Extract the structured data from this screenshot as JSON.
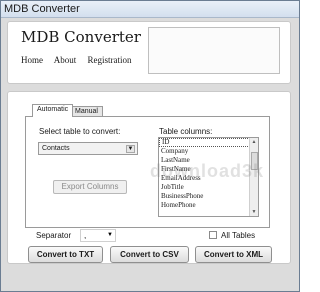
{
  "window": {
    "title": "MDB Converter"
  },
  "header": {
    "app_name": "MDB Converter",
    "nav": [
      "Home",
      "About",
      "Registration"
    ]
  },
  "tabs": [
    {
      "label": "Automatic",
      "active": true
    },
    {
      "label": "Manual",
      "active": false
    }
  ],
  "select_table": {
    "label": "Select table to convert:",
    "value": "Contacts"
  },
  "columns": {
    "label": "Table columns:",
    "items": [
      "ID",
      "Company",
      "LastName",
      "FirstName",
      "EmailAddress",
      "JobTitle",
      "BusinessPhone",
      "HomePhone"
    ]
  },
  "export_columns_button": "Export Columns",
  "separator": {
    "label": "Separator",
    "value": ","
  },
  "all_tables": {
    "label": "All Tables",
    "checked": false
  },
  "buttons": {
    "txt": "Convert to TXT",
    "csv": "Convert to CSV",
    "xml": "Convert to XML"
  },
  "watermark": "download3k"
}
